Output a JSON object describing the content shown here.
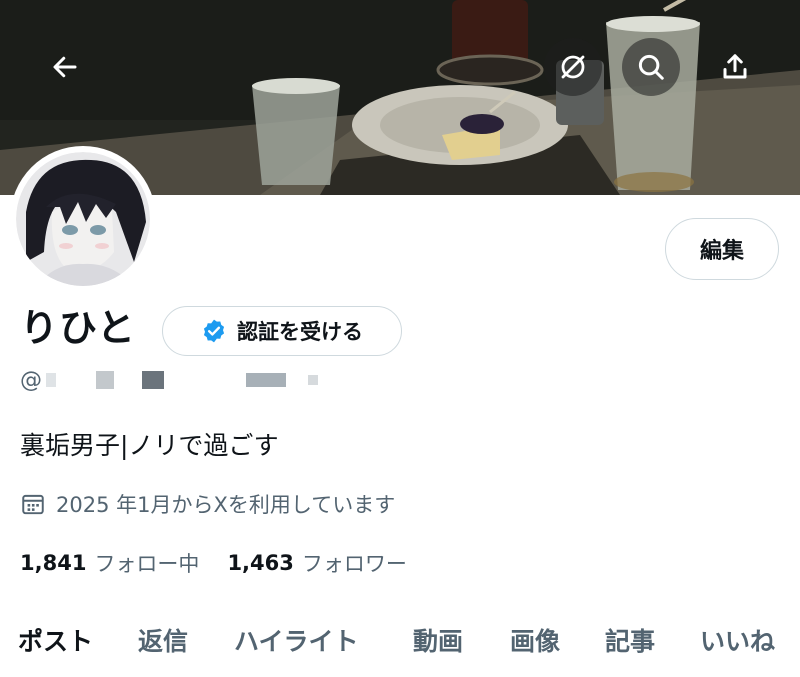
{
  "header": {
    "back_icon": "arrow-left-icon",
    "sync_icon": "circle-slash-icon",
    "search_icon": "search-icon",
    "share_icon": "share-upload-icon"
  },
  "profile": {
    "display_name": "りひと",
    "verify_label": "認証を受ける",
    "handle_prefix": "@",
    "edit_label": "編集",
    "bio": "裏垢男子|ノリで過ごす",
    "joined": "2025 年1月からXを利用しています",
    "following_count": "1,841",
    "following_label": "フォロー中",
    "followers_count": "1,463",
    "followers_label": "フォロワー"
  },
  "tabs": [
    {
      "label": "ポスト",
      "active": true
    },
    {
      "label": "返信",
      "active": false
    },
    {
      "label": "ハイライト",
      "active": false
    },
    {
      "label": "動画",
      "active": false
    },
    {
      "label": "画像",
      "active": false
    },
    {
      "label": "記事",
      "active": false
    },
    {
      "label": "いいね",
      "active": false
    }
  ],
  "colors": {
    "text_primary": "#0f1419",
    "text_secondary": "#536471",
    "border": "#cfd9de",
    "verified_blue": "#1d9bf0"
  }
}
